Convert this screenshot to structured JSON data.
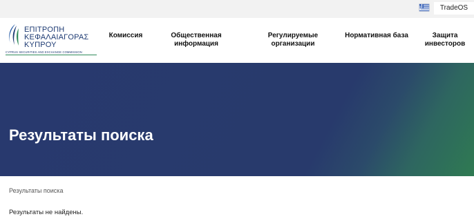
{
  "topbar": {
    "language_flag_icon": "greek-flag-icon",
    "tradeos_label": "TradeOS"
  },
  "logo": {
    "line1": "ΕΠΙΤΡΟΠΗ",
    "line2": "ΚΕΦΑΛΑΙΑΓΟΡΑΣ",
    "line3": "ΚΥΠΡΟΥ",
    "subtitle": "CYPRUS SECURITIES AND EXCHANGE COMMISSION",
    "brand_color": "#1e3b73",
    "accent_color": "#2f8a5a"
  },
  "nav": {
    "items": [
      {
        "label": "Комиссия"
      },
      {
        "label": "Общественная информация"
      },
      {
        "label": "Регулируемые организации"
      },
      {
        "label": "Нормативная база"
      },
      {
        "label": "Защита инвесторов"
      }
    ]
  },
  "hero": {
    "title": "Результаты поиска",
    "color_primary": "#28396e",
    "color_secondary": "#2f7a52"
  },
  "main": {
    "breadcrumb": "Результаты поиска",
    "message": "Результаты не найдены."
  }
}
